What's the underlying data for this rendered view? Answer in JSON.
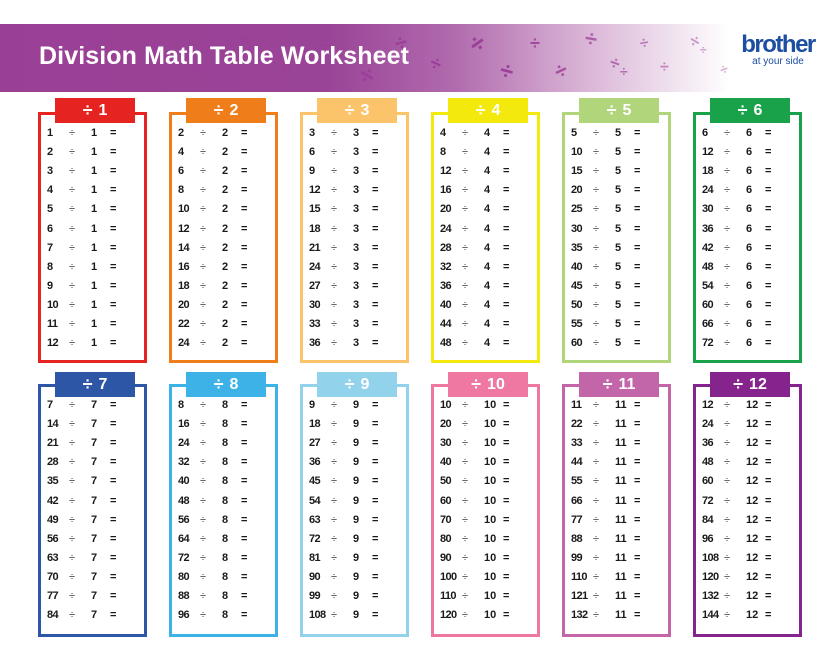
{
  "header": {
    "title": "Division Math Table Worksheet",
    "banner_color": "#9a4497",
    "decor_symbol": "÷"
  },
  "logo": {
    "wordmark": "brother",
    "tagline": "at your side",
    "color": "#1c4ea1"
  },
  "symbols": {
    "divide": "÷",
    "equals": "="
  },
  "tables": [
    {
      "divisor": 1,
      "label": "1",
      "color": "#e52421",
      "dividends": [
        1,
        2,
        3,
        4,
        5,
        6,
        7,
        8,
        9,
        10,
        11,
        12
      ]
    },
    {
      "divisor": 2,
      "label": "2",
      "color": "#ef7d1a",
      "dividends": [
        2,
        4,
        6,
        8,
        10,
        12,
        14,
        16,
        18,
        20,
        22,
        24
      ]
    },
    {
      "divisor": 3,
      "label": "3",
      "color": "#fbc36a",
      "dividends": [
        3,
        6,
        9,
        12,
        15,
        18,
        21,
        24,
        27,
        30,
        33,
        36
      ]
    },
    {
      "divisor": 4,
      "label": "4",
      "color": "#f4e90d",
      "dividends": [
        4,
        8,
        12,
        16,
        20,
        24,
        28,
        32,
        36,
        40,
        44,
        48
      ]
    },
    {
      "divisor": 5,
      "label": "5",
      "color": "#b1d57b",
      "dividends": [
        5,
        10,
        15,
        20,
        25,
        30,
        35,
        40,
        45,
        50,
        55,
        60
      ]
    },
    {
      "divisor": 6,
      "label": "6",
      "color": "#1aa24a",
      "dividends": [
        6,
        12,
        18,
        24,
        30,
        36,
        42,
        48,
        54,
        60,
        66,
        72
      ]
    },
    {
      "divisor": 7,
      "label": "7",
      "color": "#2e56a6",
      "dividends": [
        7,
        14,
        21,
        28,
        35,
        42,
        49,
        56,
        63,
        70,
        77,
        84
      ]
    },
    {
      "divisor": 8,
      "label": "8",
      "color": "#3db2e6",
      "dividends": [
        8,
        16,
        24,
        32,
        40,
        48,
        56,
        64,
        72,
        80,
        88,
        96
      ]
    },
    {
      "divisor": 9,
      "label": "9",
      "color": "#92d2ea",
      "dividends": [
        9,
        18,
        27,
        36,
        45,
        54,
        63,
        72,
        81,
        90,
        99,
        108
      ]
    },
    {
      "divisor": 10,
      "label": "10",
      "color": "#ee78a2",
      "dividends": [
        10,
        20,
        30,
        40,
        50,
        60,
        70,
        80,
        90,
        100,
        110,
        120
      ]
    },
    {
      "divisor": 11,
      "label": "11",
      "color": "#c266a9",
      "dividends": [
        11,
        22,
        33,
        44,
        55,
        66,
        77,
        88,
        99,
        110,
        121,
        132
      ]
    },
    {
      "divisor": 12,
      "label": "12",
      "color": "#86248d",
      "dividends": [
        12,
        24,
        36,
        48,
        60,
        72,
        84,
        96,
        108,
        120,
        132,
        144
      ]
    }
  ]
}
